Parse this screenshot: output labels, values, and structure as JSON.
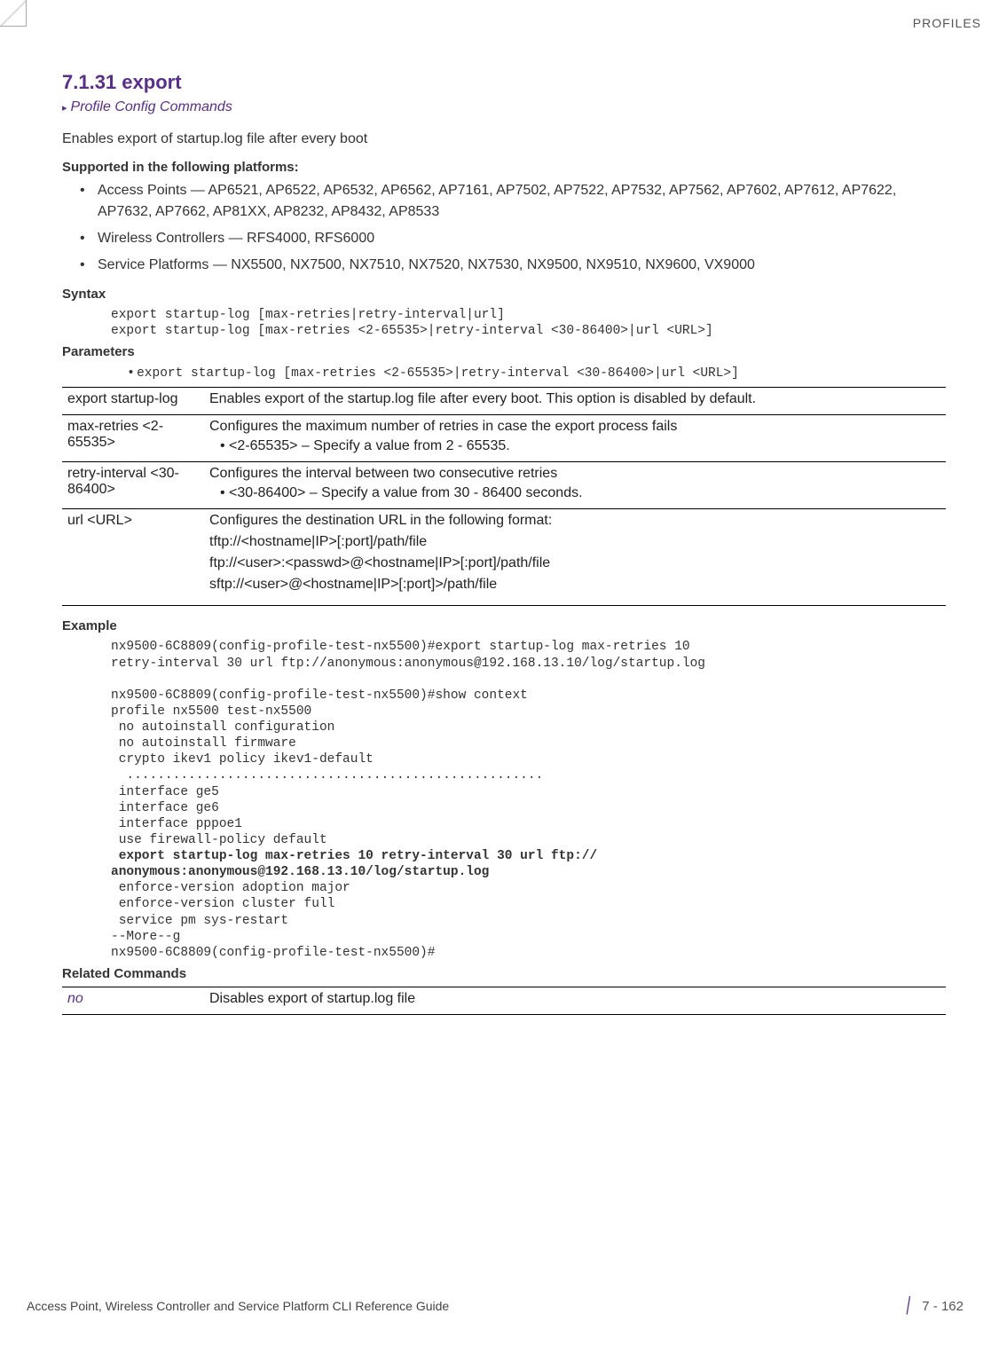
{
  "header_right": "PROFILES",
  "title": "7.1.31 export",
  "breadcrumb": "Profile Config Commands",
  "intro": "Enables export of startup.log file after every boot",
  "supported_label": "Supported in the following platforms:",
  "platforms": [
    "Access Points — AP6521, AP6522, AP6532, AP6562, AP7161, AP7502, AP7522, AP7532, AP7562, AP7602, AP7612, AP7622, AP7632, AP7662, AP81XX, AP8232, AP8432, AP8533",
    "Wireless Controllers — RFS4000, RFS6000",
    "Service Platforms — NX5500, NX7500, NX7510, NX7520, NX7530, NX9500, NX9510, NX9600, VX9000"
  ],
  "syntax_label": "Syntax",
  "syntax_text": "export startup-log [max-retries|retry-interval|url]\nexport startup-log [max-retries <2-65535>|retry-interval <30-86400>|url <URL>]",
  "parameters_label": "Parameters",
  "parameters_header": "export startup-log [max-retries <2-65535>|retry-interval <30-86400>|url <URL>]",
  "params_table": [
    {
      "name": "export startup-log",
      "desc": "Enables export of the startup.log file after every boot. This option is disabled by default."
    },
    {
      "name": "max-retries <2-65535>",
      "desc": "Configures the maximum number of retries in case the export process fails",
      "sub": "<2-65535> – Specify a value from 2 - 65535."
    },
    {
      "name": "retry-interval <30-86400>",
      "desc": "Configures the interval between two consecutive retries",
      "sub": "<30-86400> – Specify a value from 30 - 86400 seconds."
    },
    {
      "name": "url <URL>",
      "desc": "Configures the destination URL in the following format:",
      "lines": [
        "tftp://<hostname|IP>[:port]/path/file",
        "ftp://<user>:<passwd>@<hostname|IP>[:port]/path/file",
        "sftp://<user>@<hostname|IP>[:port]>/path/file"
      ]
    }
  ],
  "example_label": "Example",
  "example_pre": "nx9500-6C8809(config-profile-test-nx5500)#export startup-log max-retries 10 \nretry-interval 30 url ftp://anonymous:anonymous@192.168.13.10/log/startup.log\n\nnx9500-6C8809(config-profile-test-nx5500)#show context\nprofile nx5500 test-nx5500\n no autoinstall configuration\n no autoinstall firmware\n crypto ikev1 policy ikev1-default\n  ......................................................\n interface ge5\n interface ge6\n interface pppoe1\n use firewall-policy default",
  "example_bold": " export startup-log max-retries 10 retry-interval 30 url ftp://\nanonymous:anonymous@192.168.13.10/log/startup.log",
  "example_post": " enforce-version adoption major\n enforce-version cluster full\n service pm sys-restart\n--More--g\nnx9500-6C8809(config-profile-test-nx5500)#",
  "related_label": "Related Commands",
  "related_table": [
    {
      "name": "no",
      "desc": "Disables export of startup.log file"
    }
  ],
  "footer_left": "Access Point, Wireless Controller and Service Platform CLI Reference Guide",
  "footer_page": "7 - 162"
}
